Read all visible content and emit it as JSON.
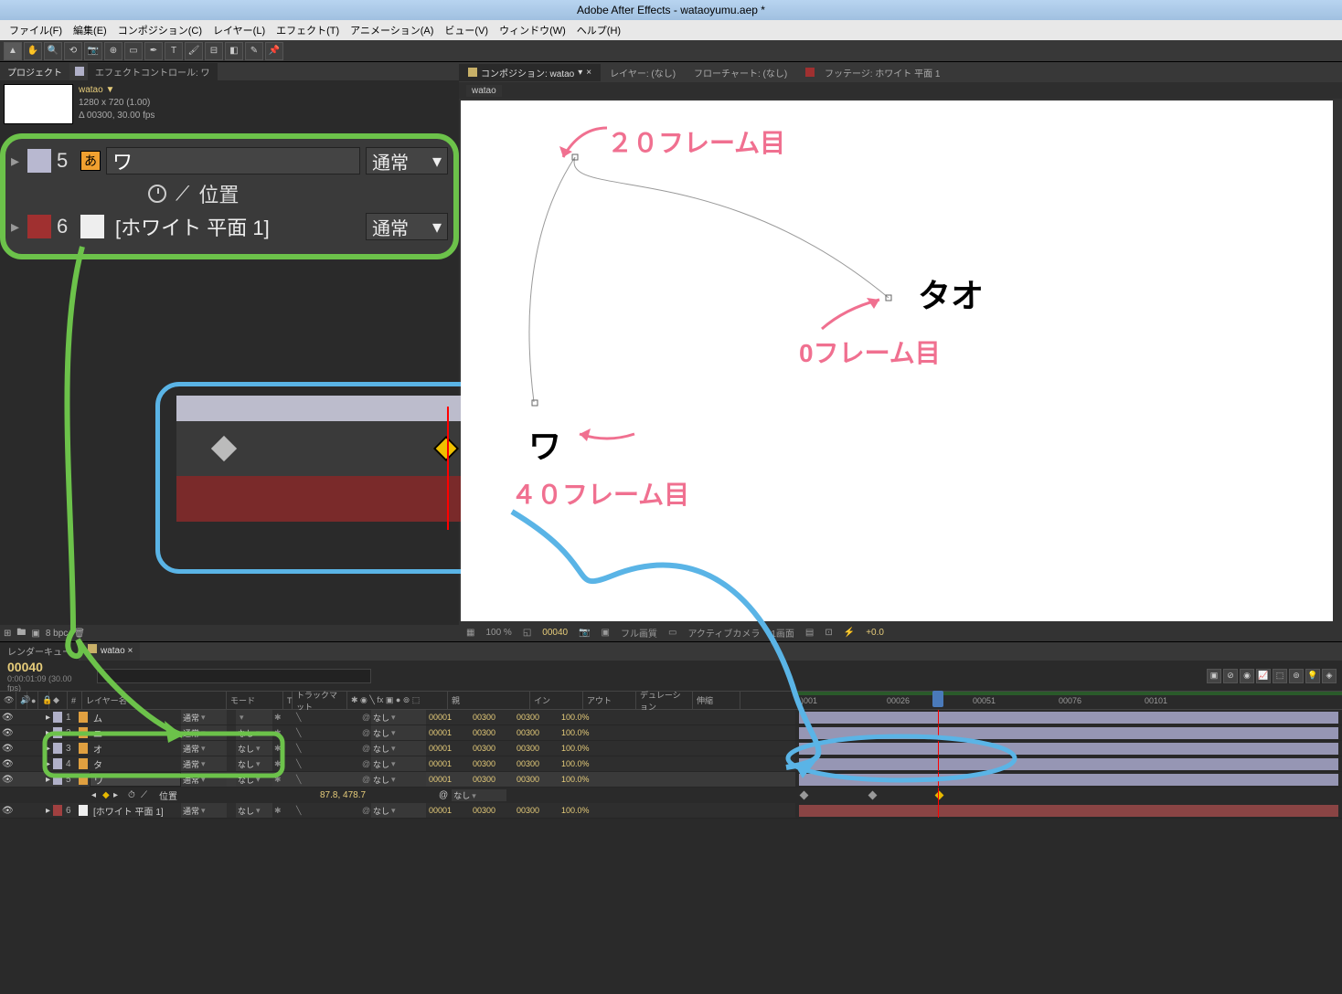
{
  "app": {
    "title": "Adobe After Effects - wataoyumu.aep *"
  },
  "menu": {
    "file": "ファイル(F)",
    "edit": "編集(E)",
    "comp": "コンポジション(C)",
    "layer": "レイヤー(L)",
    "effect": "エフェクト(T)",
    "anim": "アニメーション(A)",
    "view": "ビュー(V)",
    "window": "ウィンドウ(W)",
    "help": "ヘルプ(H)"
  },
  "project_panel": {
    "tabs": {
      "project": "プロジェクト",
      "effect_controls": "エフェクトコントロール: ワ"
    },
    "comp": {
      "name": "watao ▼",
      "size": "1280 x 720 (1.00)",
      "duration": "Δ 00300, 30.00 fps"
    }
  },
  "layer_detail": {
    "row5": {
      "num": "5",
      "name": "ワ",
      "mode": "通常",
      "property": "位置"
    },
    "row6": {
      "num": "6",
      "name": "[ホワイト 平面 1]",
      "mode": "通常"
    }
  },
  "footer_left": {
    "bpc": "8 bpc"
  },
  "viewer": {
    "tabs": {
      "comp": "コンポジション: watao",
      "layer": "レイヤー: (なし)",
      "flowchart": "フローチャート: (なし)",
      "footage": "フッテージ: ホワイト 平面 1"
    },
    "subtab": "watao",
    "zoom": "100 %",
    "frame": "00040",
    "quality": "フル画質",
    "camera": "アクティブカメラ",
    "views": "1画面",
    "exposure": "+0.0"
  },
  "annotations": {
    "frame0": "0フレーム目",
    "frame20": "２０フレーム目",
    "frame40": "４０フレーム目",
    "text_tao": "タオ",
    "text_wa": "ワ"
  },
  "timeline": {
    "tabs": {
      "rq": "レンダーキュー",
      "comp": "watao"
    },
    "timecode": "00040",
    "timecode_sub": "0:00:01:09 (30.00 fps)",
    "columns": {
      "layer_name": "レイヤー名",
      "mode": "モード",
      "trkmat": "トラックマット",
      "parent": "親",
      "in": "イン",
      "out": "アウト",
      "duration": "デュレーション",
      "stretch": "伸縮"
    },
    "ruler": {
      "t0": ")001",
      "t1": "00026",
      "t2": "00051",
      "t3": "00076",
      "t4": "00101"
    },
    "layers": [
      {
        "num": "1",
        "name": "ム",
        "mode": "通常",
        "trkmat": "",
        "parent": "なし",
        "in": "00001",
        "out": "00300",
        "dur": "00300",
        "stretch": "100.0%",
        "color": "#b0b0c8"
      },
      {
        "num": "2",
        "name": "ユ",
        "mode": "通常",
        "trkmat": "なし",
        "parent": "なし",
        "in": "00001",
        "out": "00300",
        "dur": "00300",
        "stretch": "100.0%",
        "color": "#b0b0c8"
      },
      {
        "num": "3",
        "name": "オ",
        "mode": "通常",
        "trkmat": "なし",
        "parent": "なし",
        "in": "00001",
        "out": "00300",
        "dur": "00300",
        "stretch": "100.0%",
        "color": "#b0b0c8"
      },
      {
        "num": "4",
        "name": "タ",
        "mode": "通常",
        "trkmat": "なし",
        "parent": "なし",
        "in": "00001",
        "out": "00300",
        "dur": "00300",
        "stretch": "100.0%",
        "color": "#b0b0c8"
      },
      {
        "num": "5",
        "name": "ワ",
        "mode": "通常",
        "trkmat": "なし",
        "parent": "なし",
        "in": "00001",
        "out": "00300",
        "dur": "00300",
        "stretch": "100.0%",
        "color": "#b0b0c8"
      },
      {
        "num": "6",
        "name": "[ホワイト 平面 1]",
        "mode": "通常",
        "trkmat": "なし",
        "parent": "なし",
        "in": "00001",
        "out": "00300",
        "dur": "00300",
        "stretch": "100.0%",
        "color": "#a04040"
      }
    ],
    "position_prop": {
      "label": "位置",
      "value": "87.8, 478.7",
      "parent_none": "なし"
    },
    "common": {
      "none": "なし",
      "normal": "通常",
      "t_label": "T"
    }
  }
}
